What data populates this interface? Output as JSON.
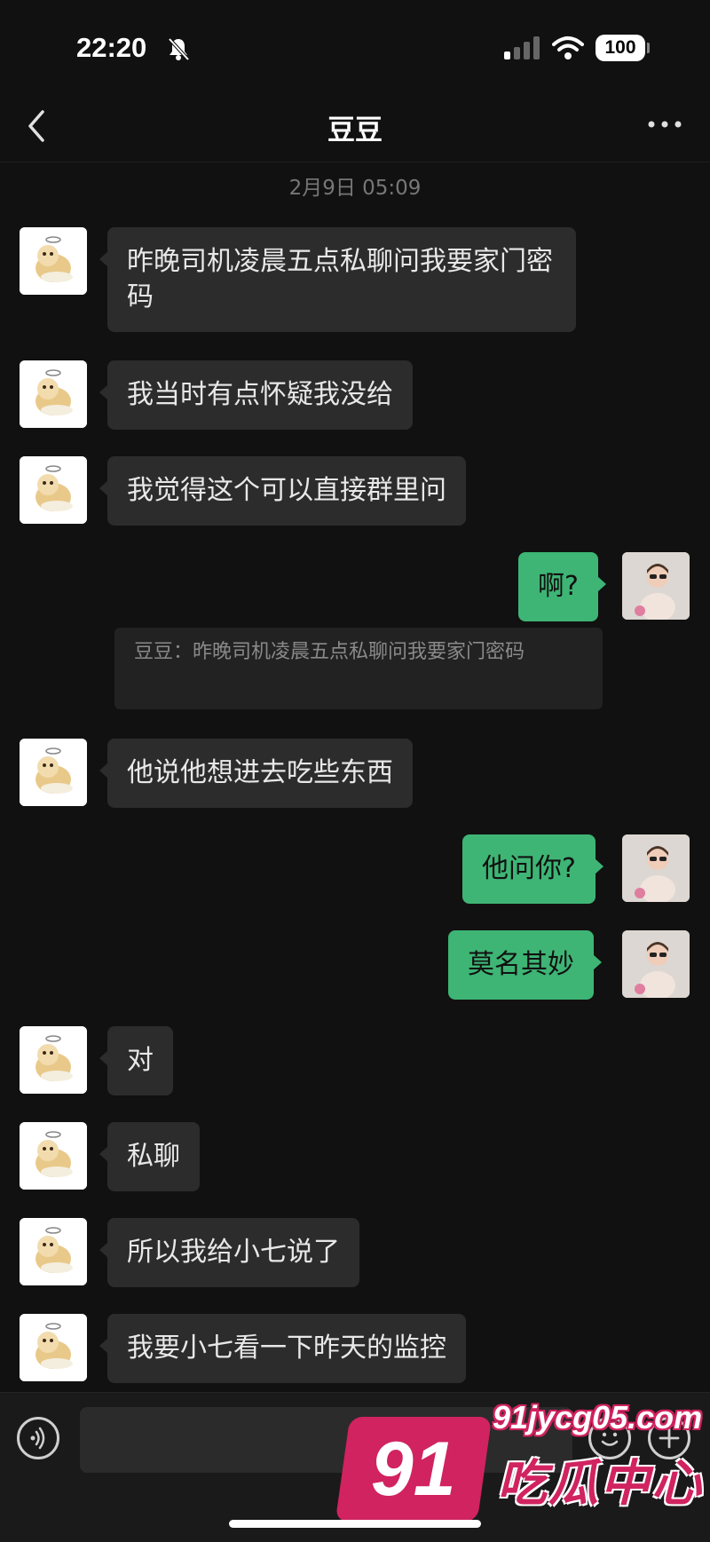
{
  "status_bar": {
    "time": "22:20",
    "battery": "100",
    "icons": [
      "bell-off-icon",
      "signal-icon",
      "wifi-icon",
      "battery-icon"
    ]
  },
  "nav": {
    "title": "豆豆",
    "back_icon": "chevron-left-icon",
    "more_icon": "more-icon"
  },
  "timestamp": "2月9日 05:09",
  "messages": [
    {
      "side": "left",
      "text": "昨晚司机凌晨五点私聊问我要家门密码"
    },
    {
      "side": "left",
      "text": "我当时有点怀疑我没给"
    },
    {
      "side": "left",
      "text": "我觉得这个可以直接群里问"
    },
    {
      "side": "right",
      "text": "啊?"
    },
    {
      "side": "left",
      "text": "他说他想进去吃些东西"
    },
    {
      "side": "right",
      "text": "他问你?"
    },
    {
      "side": "right",
      "text": "莫名其妙"
    },
    {
      "side": "left",
      "text": "对"
    },
    {
      "side": "left",
      "text": "私聊"
    },
    {
      "side": "left",
      "text": "所以我给小七说了"
    },
    {
      "side": "left",
      "text": "我要小七看一下昨天的监控"
    }
  ],
  "quote": {
    "text": "豆豆：昨晚司机凌晨五点私聊问我要家门密码"
  },
  "input_bar": {
    "voice_icon": "voice-icon",
    "emoji_icon": "emoji-icon",
    "plus_icon": "plus-icon",
    "input_value": ""
  },
  "watermark": {
    "number": "91",
    "url": "91jycg05.com",
    "name": "吃瓜中心"
  },
  "colors": {
    "background": "#111111",
    "bubble_incoming": "#2c2c2c",
    "bubble_outgoing": "#3eb575",
    "watermark": "#d0235f"
  }
}
